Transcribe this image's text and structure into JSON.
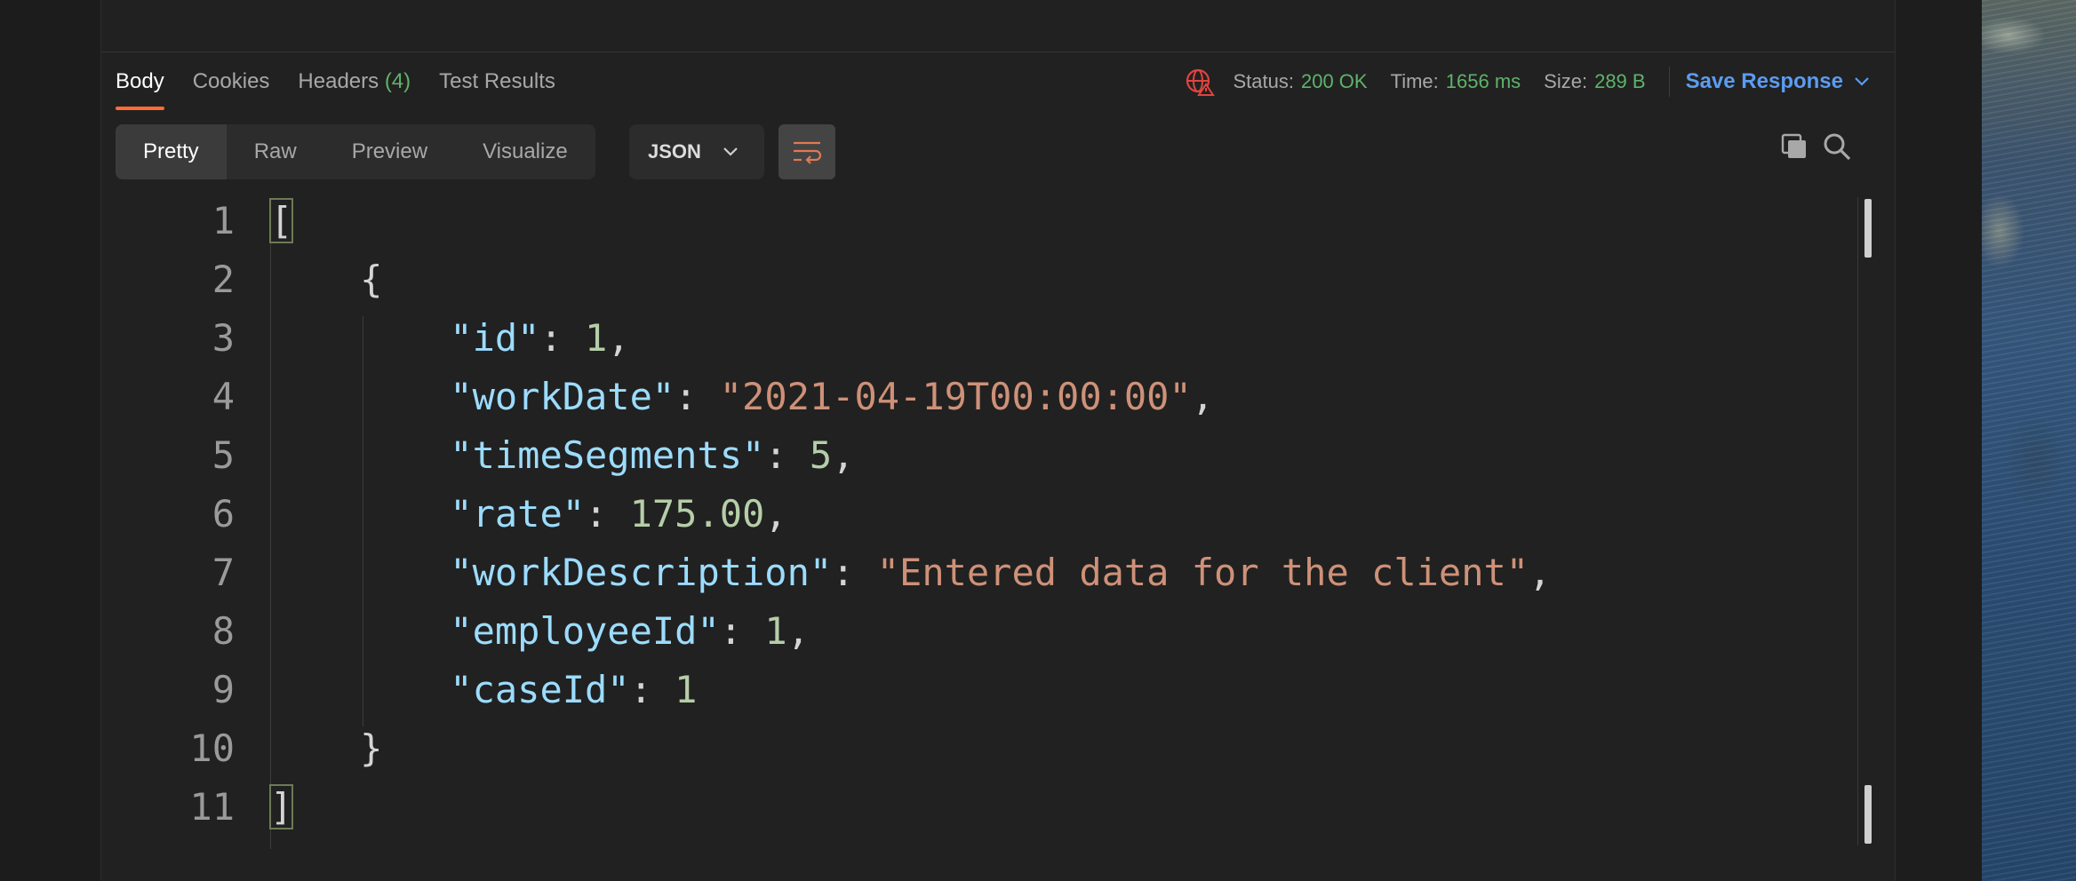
{
  "response_tabs": [
    {
      "label": "Body",
      "active": true
    },
    {
      "label": "Cookies"
    },
    {
      "label": "Headers",
      "count": "(4)"
    },
    {
      "label": "Test Results"
    }
  ],
  "status_bar": {
    "status_label": "Status:",
    "status_value": "200 OK",
    "time_label": "Time:",
    "time_value": "1656 ms",
    "size_label": "Size:",
    "size_value": "289 B",
    "save_label": "Save Response"
  },
  "view_modes": [
    "Pretty",
    "Raw",
    "Preview",
    "Visualize"
  ],
  "selected_view": "Pretty",
  "format_select": "JSON",
  "code_lines": [
    {
      "n": "1",
      "tokens": [
        [
          "p",
          "["
        ]
      ]
    },
    {
      "n": "2",
      "tokens": [
        [
          "p",
          "    {"
        ]
      ]
    },
    {
      "n": "3",
      "tokens": [
        [
          "p",
          "        "
        ],
        [
          "k",
          "\"id\""
        ],
        [
          "p",
          ": "
        ],
        [
          "n",
          "1"
        ],
        [
          "p",
          ","
        ]
      ]
    },
    {
      "n": "4",
      "tokens": [
        [
          "p",
          "        "
        ],
        [
          "k",
          "\"workDate\""
        ],
        [
          "p",
          ": "
        ],
        [
          "s",
          "\"2021-04-19T00:00:00\""
        ],
        [
          "p",
          ","
        ]
      ]
    },
    {
      "n": "5",
      "tokens": [
        [
          "p",
          "        "
        ],
        [
          "k",
          "\"timeSegments\""
        ],
        [
          "p",
          ": "
        ],
        [
          "n",
          "5"
        ],
        [
          "p",
          ","
        ]
      ]
    },
    {
      "n": "6",
      "tokens": [
        [
          "p",
          "        "
        ],
        [
          "k",
          "\"rate\""
        ],
        [
          "p",
          ": "
        ],
        [
          "n",
          "175.00"
        ],
        [
          "p",
          ","
        ]
      ]
    },
    {
      "n": "7",
      "tokens": [
        [
          "p",
          "        "
        ],
        [
          "k",
          "\"workDescription\""
        ],
        [
          "p",
          ": "
        ],
        [
          "s",
          "\"Entered data for the client\""
        ],
        [
          "p",
          ","
        ]
      ]
    },
    {
      "n": "8",
      "tokens": [
        [
          "p",
          "        "
        ],
        [
          "k",
          "\"employeeId\""
        ],
        [
          "p",
          ": "
        ],
        [
          "n",
          "1"
        ],
        [
          "p",
          ","
        ]
      ]
    },
    {
      "n": "9",
      "tokens": [
        [
          "p",
          "        "
        ],
        [
          "k",
          "\"caseId\""
        ],
        [
          "p",
          ": "
        ],
        [
          "n",
          "1"
        ]
      ]
    },
    {
      "n": "10",
      "tokens": [
        [
          "p",
          "    }"
        ]
      ]
    },
    {
      "n": "11",
      "tokens": [
        [
          "p",
          "]"
        ]
      ]
    }
  ],
  "colors": {
    "accent": "#ff6c37",
    "status_ok": "#5fb36a",
    "link": "#5b9cf0",
    "json_key": "#9cdcfe",
    "json_string": "#ce9178",
    "json_number": "#b5cea8"
  },
  "icons": [
    "globe-warning-icon",
    "chevron-down-icon",
    "wrap-lines-icon",
    "copy-icon",
    "search-icon"
  ]
}
